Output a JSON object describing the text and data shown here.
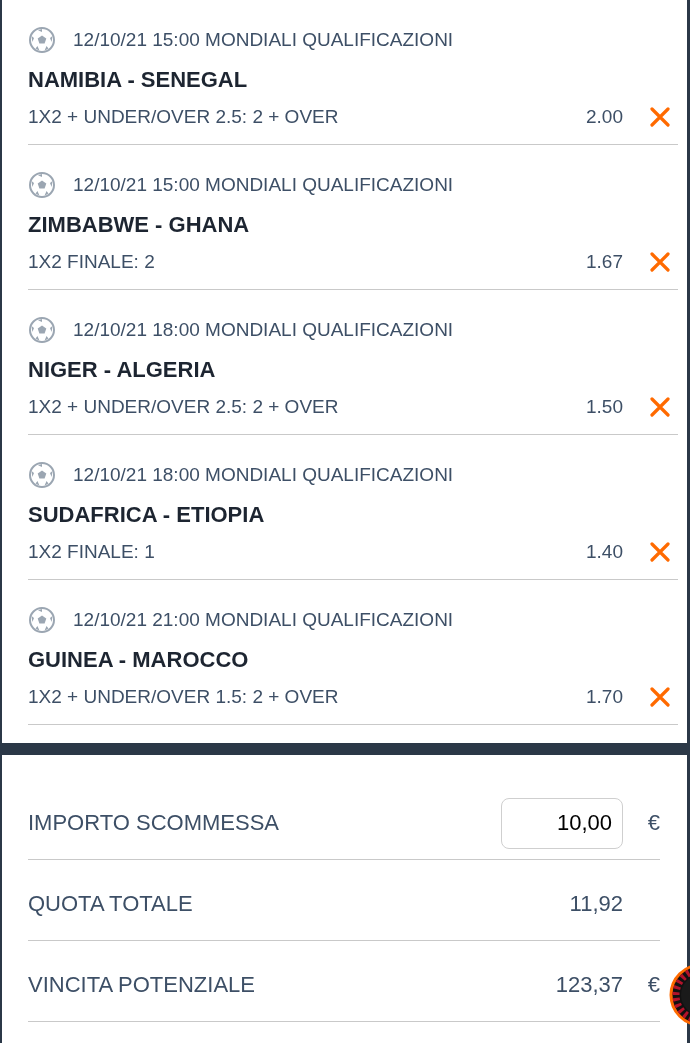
{
  "bets": [
    {
      "header": "12/10/21 15:00 MONDIALI QUALIFICAZIONI",
      "match": "NAMIBIA - SENEGAL",
      "market": "1X2 + UNDER/OVER 2.5: 2 + OVER",
      "odds": "2.00"
    },
    {
      "header": "12/10/21 15:00 MONDIALI QUALIFICAZIONI",
      "match": "ZIMBABWE - GHANA",
      "market": "1X2 FINALE: 2",
      "odds": "1.67"
    },
    {
      "header": "12/10/21 18:00 MONDIALI QUALIFICAZIONI",
      "match": "NIGER - ALGERIA",
      "market": "1X2 + UNDER/OVER 2.5: 2 + OVER",
      "odds": "1.50"
    },
    {
      "header": "12/10/21 18:00 MONDIALI QUALIFICAZIONI",
      "match": "SUDAFRICA - ETIOPIA",
      "market": "1X2 FINALE: 1",
      "odds": "1.40"
    },
    {
      "header": "12/10/21 21:00 MONDIALI QUALIFICAZIONI",
      "match": "GUINEA - MAROCCO",
      "market": "1X2 + UNDER/OVER 1.5: 2 + OVER",
      "odds": "1.70"
    }
  ],
  "summary": [
    {
      "kind": "input",
      "label": "IMPORTO SCOMMESSA",
      "value": "10,00",
      "currency": "€"
    },
    {
      "kind": "text",
      "label": "QUOTA TOTALE",
      "value": "11,92"
    },
    {
      "kind": "text",
      "label": "VINCITA POTENZIALE",
      "value": "123,37",
      "currency": "€"
    }
  ]
}
